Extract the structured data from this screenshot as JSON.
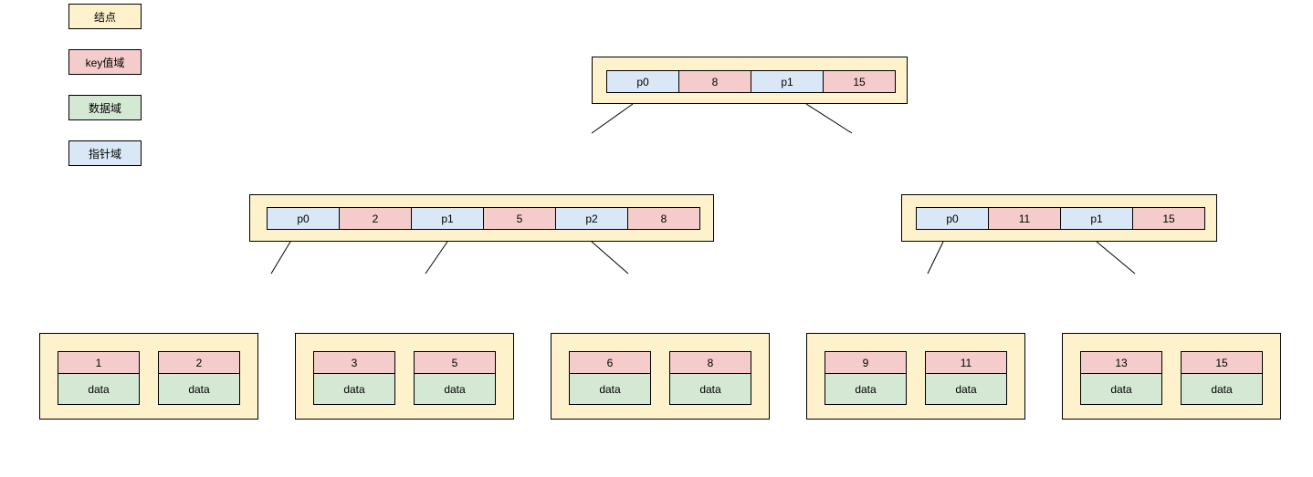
{
  "legend": {
    "node": "结点",
    "key": "key值域",
    "data": "数据域",
    "ptr": "指针域"
  },
  "root": {
    "cells": [
      {
        "kind": "ptr",
        "label": "p0"
      },
      {
        "kind": "key",
        "label": "8"
      },
      {
        "kind": "ptr",
        "label": "p1"
      },
      {
        "kind": "key",
        "label": "15"
      }
    ]
  },
  "internal": [
    {
      "cells": [
        {
          "kind": "ptr",
          "label": "p0"
        },
        {
          "kind": "key",
          "label": "2"
        },
        {
          "kind": "ptr",
          "label": "p1"
        },
        {
          "kind": "key",
          "label": "5"
        },
        {
          "kind": "ptr",
          "label": "p2"
        },
        {
          "kind": "key",
          "label": "8"
        }
      ]
    },
    {
      "cells": [
        {
          "kind": "ptr",
          "label": "p0"
        },
        {
          "kind": "key",
          "label": "11"
        },
        {
          "kind": "ptr",
          "label": "p1"
        },
        {
          "kind": "key",
          "label": "15"
        }
      ]
    }
  ],
  "leaves": [
    {
      "entries": [
        {
          "key": "1",
          "data": "data"
        },
        {
          "key": "2",
          "data": "data"
        }
      ]
    },
    {
      "entries": [
        {
          "key": "3",
          "data": "data"
        },
        {
          "key": "5",
          "data": "data"
        }
      ]
    },
    {
      "entries": [
        {
          "key": "6",
          "data": "data"
        },
        {
          "key": "8",
          "data": "data"
        }
      ]
    },
    {
      "entries": [
        {
          "key": "9",
          "data": "data"
        },
        {
          "key": "11",
          "data": "data"
        }
      ]
    },
    {
      "entries": [
        {
          "key": "13",
          "data": "data"
        },
        {
          "key": "15",
          "data": "data"
        }
      ]
    }
  ],
  "data_label": "data"
}
